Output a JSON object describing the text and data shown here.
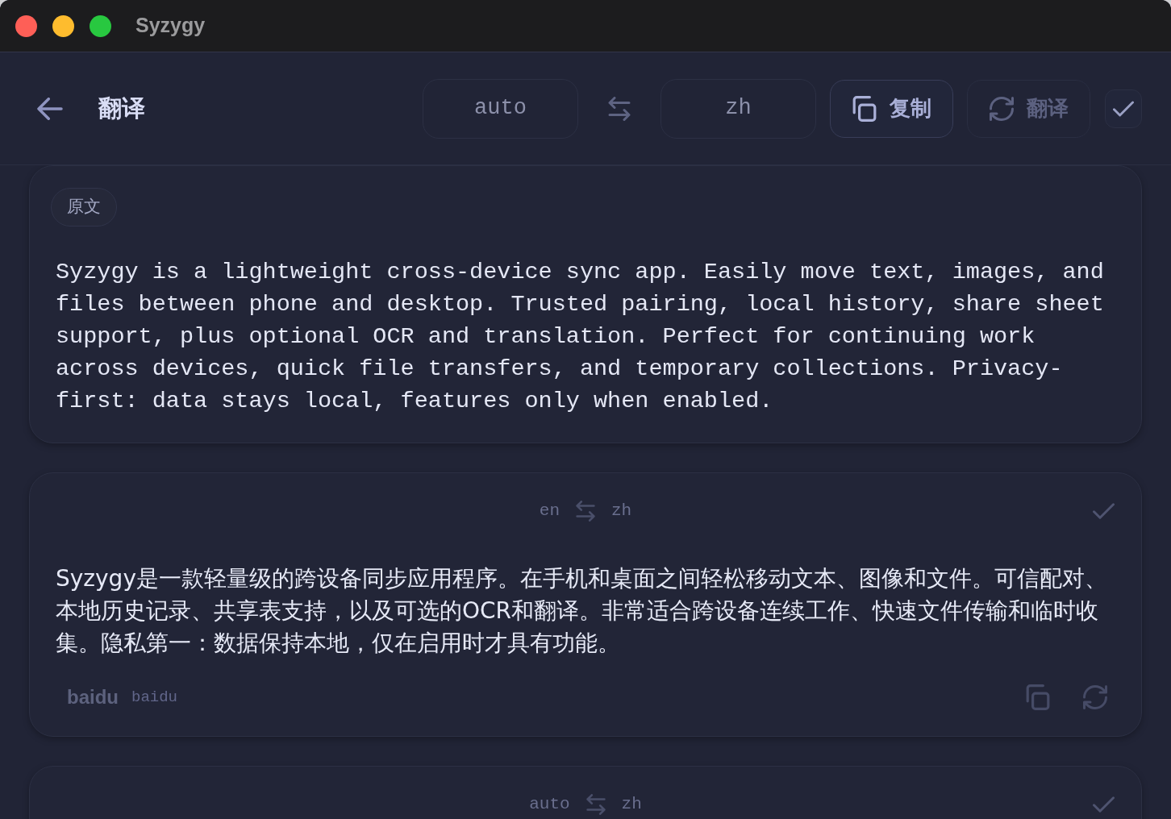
{
  "window": {
    "title": "Syzygy"
  },
  "header": {
    "title": "翻译",
    "source_language": "auto",
    "target_language": "zh",
    "actions": [
      {
        "kind": "copy",
        "label": "复制",
        "disabled": false
      },
      {
        "kind": "translate",
        "label": "翻译",
        "disabled": true
      },
      {
        "kind": "confirm"
      }
    ]
  },
  "source": {
    "label": "原文",
    "text": "Syzygy is a lightweight cross-device sync app. Easily move text, images, and files between phone and desktop. Trusted pairing, local history, share sheet support, plus optional OCR and translation. Perfect for continuing work across devices, quick file transfers, and temporary collections. Privacy-first: data stays local, features only when enabled."
  },
  "results": [
    {
      "source_language": "en",
      "target_language": "zh",
      "text": "Syzygy是一款轻量级的跨设备同步应用程序。在手机和桌面之间轻松移动文本、图像和文件。可信配对、本地历史记录、共享表支持，以及可选的OCR和翻译。非常适合跨设备连续工作、快速文件传输和临时收集。隐私第一：数据保持本地，仅在启用时才具有功能。",
      "engine": "baidu",
      "engine_id": "baidu"
    },
    {
      "source_language": "auto",
      "target_language": "zh"
    }
  ]
}
